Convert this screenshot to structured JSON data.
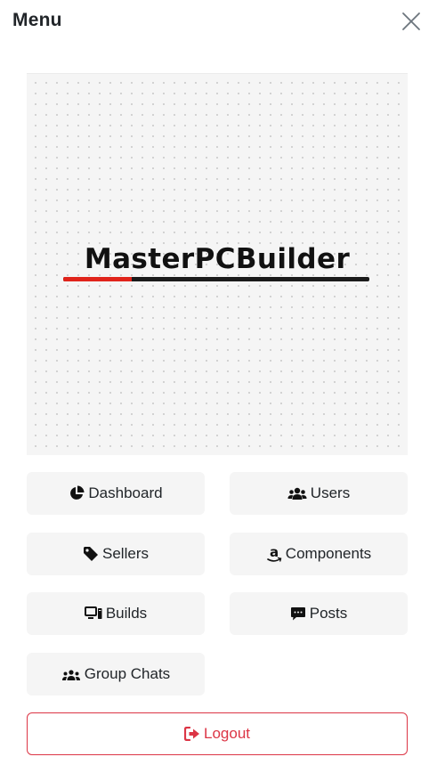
{
  "header": {
    "title": "Menu"
  },
  "logo": {
    "text": "MasterPCBuilder"
  },
  "nav": {
    "dashboard": "Dashboard",
    "users": "Users",
    "sellers": "Sellers",
    "components": "Components",
    "builds": "Builds",
    "posts": "Posts",
    "group_chats": "Group Chats",
    "logout": "Logout"
  },
  "icons": {
    "close": "close-icon",
    "dashboard": "chart-pie-icon",
    "users": "users-icon",
    "sellers": "tag-icon",
    "components": "amazon-icon",
    "builds": "computer-icon",
    "posts": "comment-icon",
    "group_chats": "people-group-icon",
    "logout": "sign-out-icon"
  },
  "colors": {
    "logout": "#dc3545",
    "logo_accent": "#e0241b",
    "button_bg": "#f5f5f5"
  }
}
